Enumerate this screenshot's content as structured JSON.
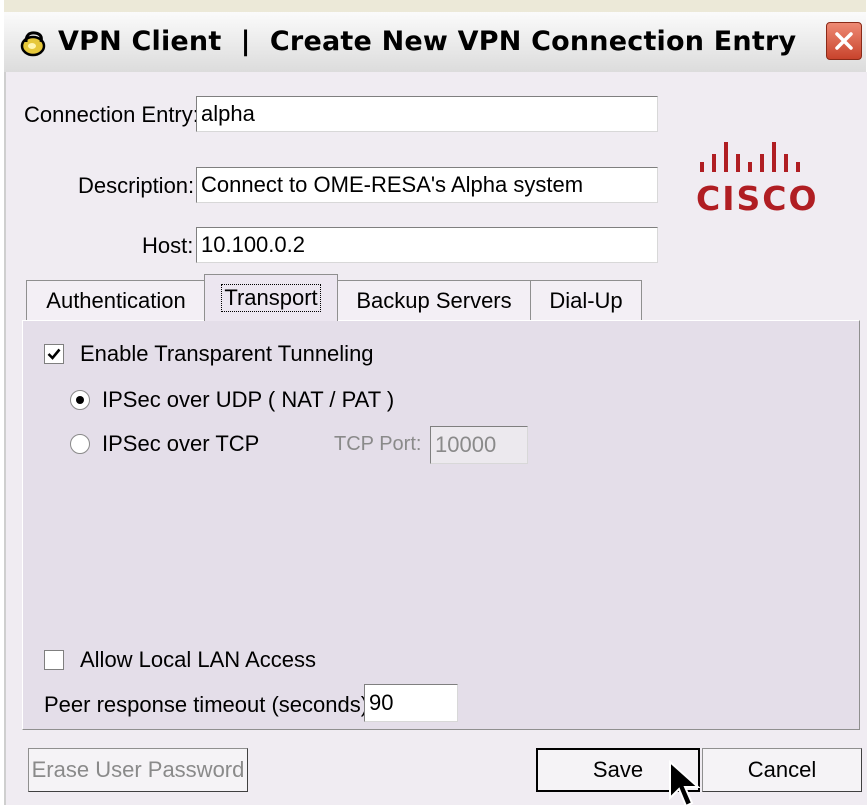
{
  "window": {
    "title": "VPN Client  |  Create New VPN Connection Entry",
    "close_label": "×",
    "icon": "lock-icon"
  },
  "form": {
    "connection_entry_label": "Connection Entry:",
    "connection_entry_value": "alpha",
    "description_label": "Description:",
    "description_value": "Connect to OME-RESA's Alpha system",
    "host_label": "Host:",
    "host_value": "10.100.0.2"
  },
  "logo": {
    "text": "CISCO",
    "color": "#b01e23"
  },
  "tabs": [
    {
      "label": "Authentication",
      "active": false
    },
    {
      "label": "Transport",
      "active": true
    },
    {
      "label": "Backup Servers",
      "active": false
    },
    {
      "label": "Dial-Up",
      "active": false
    }
  ],
  "transport": {
    "enable_tunneling_label": "Enable Transparent Tunneling",
    "enable_tunneling_checked": true,
    "udp_option_label": "IPSec over UDP ( NAT / PAT )",
    "udp_selected": true,
    "tcp_option_label": "IPSec over TCP",
    "tcp_selected": false,
    "tcp_port_label": "TCP Port:",
    "tcp_port_value": "10000",
    "allow_lan_label": "Allow Local LAN Access",
    "allow_lan_checked": false,
    "peer_timeout_label": "Peer response timeout (seconds):",
    "peer_timeout_value": "90"
  },
  "buttons": {
    "erase_password": "Erase User Password",
    "save": "Save",
    "cancel": "Cancel"
  }
}
